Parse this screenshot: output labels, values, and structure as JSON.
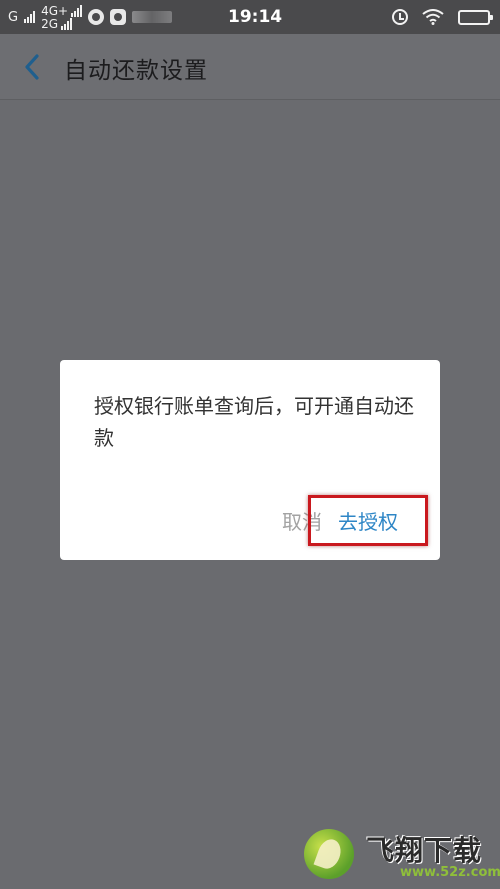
{
  "status_bar": {
    "sim1_label": "G",
    "sim2_top_label": "4G+",
    "sim2_bottom_label": "2G",
    "time": "19:14",
    "icons": [
      "signal-icon",
      "notification-icon",
      "alarm-icon",
      "wifi-icon",
      "battery-icon"
    ],
    "battery_level": 1.0
  },
  "header": {
    "back_icon": "chevron-left-icon",
    "title": "自动还款设置"
  },
  "dialog": {
    "message": "授权银行账单查询后，可开通自动还款",
    "cancel_label": "取消",
    "confirm_label": "去授权"
  },
  "watermark": {
    "text": "飞翔下载",
    "url": "www.52z.com"
  },
  "colors": {
    "accent": "#2e86c6",
    "highlight_border": "#c9181e",
    "overlay": "#6a6b6f",
    "cancel_text": "#a3a3a3"
  }
}
